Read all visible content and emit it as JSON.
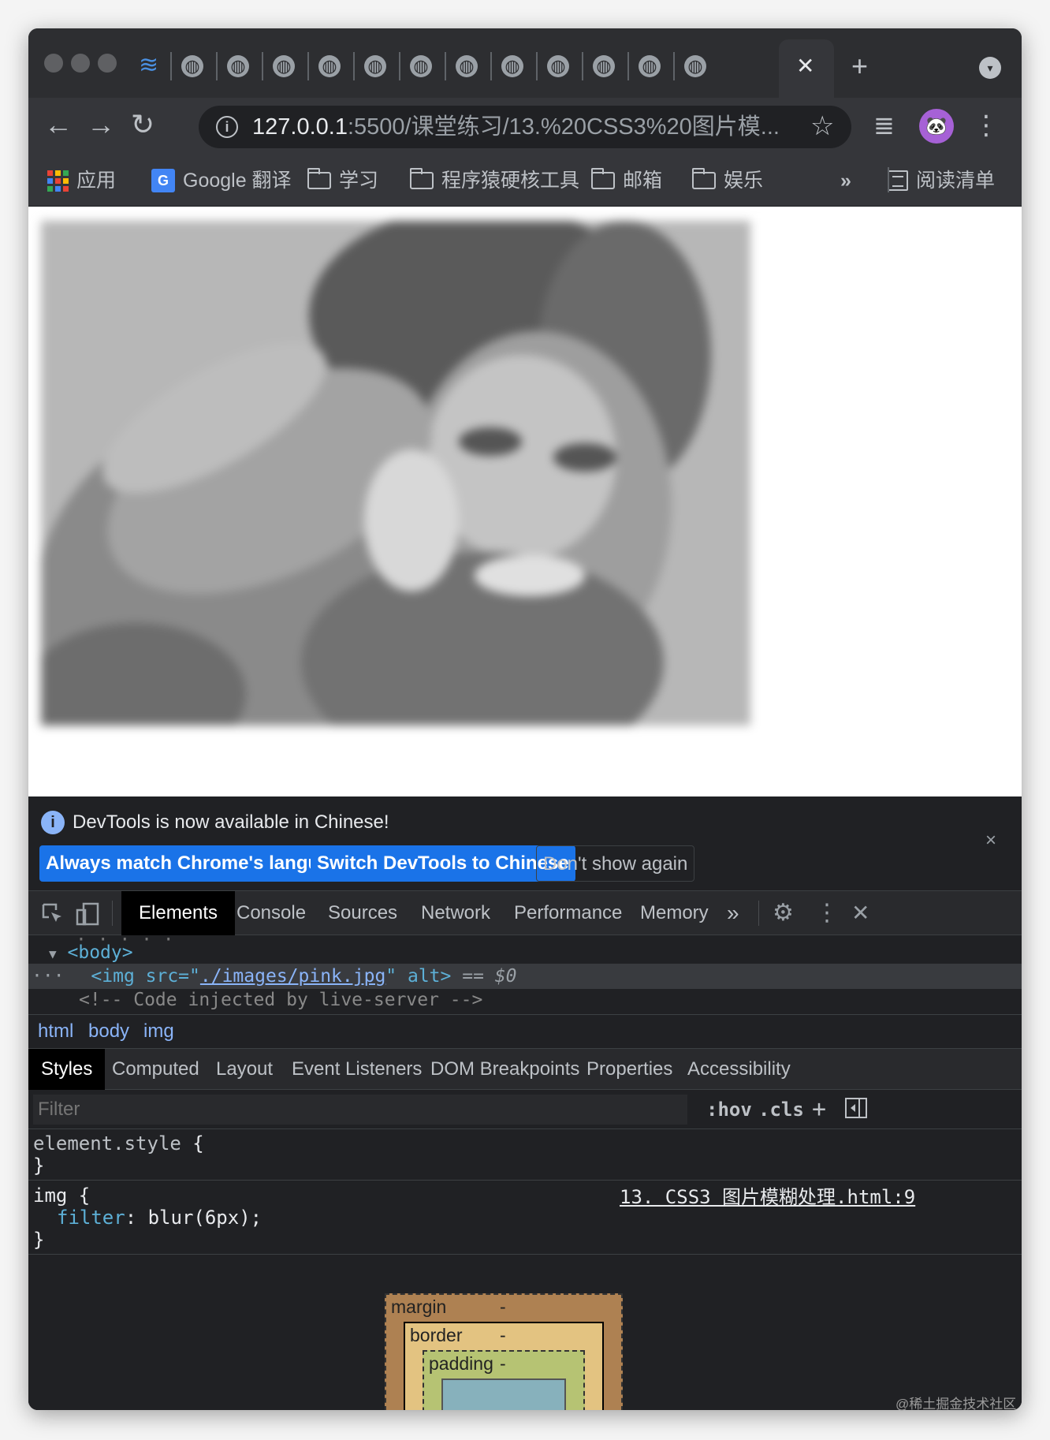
{
  "browser": {
    "address_host": "127.0.0.1",
    "address_rest": ":5500/课堂练习/13.%20CSS3%20图片模...",
    "close_tab_glyph": "✕",
    "new_tab_glyph": "+",
    "tab_search_glyph": "▾",
    "favicon_icon": "globe-icon",
    "nav": {
      "back": "←",
      "forward": "→",
      "reload": "↻",
      "star": "☆",
      "menu": "⋮",
      "media": "≣"
    },
    "avatar_glyph": "🐼"
  },
  "bookmarks": {
    "apps": "应用",
    "google_translate": "Google 翻译",
    "folders": [
      "学习",
      "程序猿硬核工具",
      "邮箱",
      "娱乐"
    ],
    "more": "»",
    "reading_list": "阅读清单"
  },
  "page": {
    "image_effect": "blur(6px)"
  },
  "devtools": {
    "banner": {
      "message": "DevTools is now available in Chinese!",
      "btn_always": "Always match Chrome's language",
      "btn_switch": "Switch DevTools to Chinese",
      "btn_dont": "Don't show again",
      "close": "×"
    },
    "tabs": [
      "Elements",
      "Console",
      "Sources",
      "Network",
      "Performance",
      "Memory"
    ],
    "tabs_more": "»",
    "dom": {
      "body_open": "<body>",
      "img_open": "<img src=\"",
      "img_src": "./images/pink.jpg",
      "img_close": "\" alt>",
      "eq_marker": "== ",
      "dollar": "$0",
      "comment": "<!-- Code injected by live-server -->",
      "ellipsis": "···"
    },
    "breadcrumbs": [
      "html",
      "body",
      "img"
    ],
    "style_tabs": [
      "Styles",
      "Computed",
      "Layout",
      "Event Listeners",
      "DOM Breakpoints",
      "Properties",
      "Accessibility"
    ],
    "filter_placeholder": "Filter",
    "hov": ":hov",
    "cls": ".cls",
    "plus": "+",
    "rules": {
      "element_selector": "element.style {",
      "close_brace": "}",
      "img_selector": "img {",
      "img_prop": "filter",
      "img_value": ": blur(6px);",
      "img_source": "13. CSS3 图片模糊处理.html:9"
    },
    "box_model": {
      "margin": "margin",
      "border": "border",
      "padding": "padding",
      "dash": "-"
    }
  },
  "watermark": "@稀土掘金技术社区"
}
